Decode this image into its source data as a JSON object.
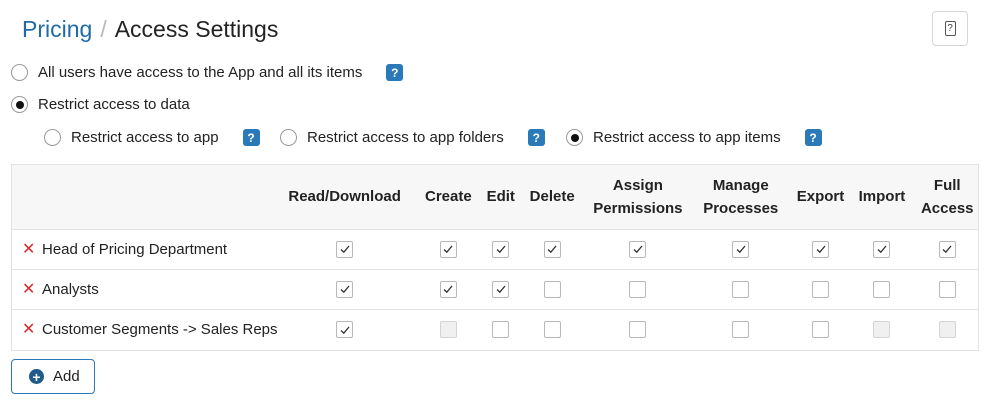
{
  "breadcrumb": {
    "parent": "Pricing",
    "separator": "/",
    "current": "Access Settings"
  },
  "help_button": {
    "icon": "help-icon",
    "glyph": "?"
  },
  "access_mode": [
    {
      "label": "All users have access to the App and all its items",
      "checked": false,
      "has_hint": true
    },
    {
      "label": "Restrict access to data",
      "checked": true,
      "has_hint": false
    }
  ],
  "restrict_options": [
    {
      "label": "Restrict access to app",
      "checked": false
    },
    {
      "label": "Restrict access to app folders",
      "checked": false
    },
    {
      "label": "Restrict access to app items",
      "checked": true
    }
  ],
  "hint_glyph": "?",
  "permissions_table": {
    "columns": [
      {
        "key": "read",
        "label": "Read/Download"
      },
      {
        "key": "create",
        "label": "Create"
      },
      {
        "key": "edit",
        "label": "Edit"
      },
      {
        "key": "delete",
        "label": "Delete"
      },
      {
        "key": "assign",
        "label": "Assign Permissions"
      },
      {
        "key": "manage",
        "label": "Manage Processes"
      },
      {
        "key": "export",
        "label": "Export"
      },
      {
        "key": "import",
        "label": "Import"
      },
      {
        "key": "full",
        "label": "Full Access"
      }
    ],
    "rows": [
      {
        "name": "Head of Pricing Department",
        "checked": [
          true,
          true,
          true,
          true,
          true,
          true,
          true,
          true,
          true
        ],
        "disabled": [
          false,
          false,
          false,
          false,
          false,
          false,
          false,
          false,
          false
        ]
      },
      {
        "name": "Analysts",
        "checked": [
          true,
          true,
          true,
          false,
          false,
          false,
          false,
          false,
          false
        ],
        "disabled": [
          false,
          false,
          false,
          false,
          false,
          false,
          false,
          false,
          false
        ]
      },
      {
        "name": "Customer Segments -> Sales Reps",
        "checked": [
          true,
          false,
          false,
          false,
          false,
          false,
          false,
          false,
          false
        ],
        "disabled": [
          false,
          true,
          false,
          false,
          false,
          false,
          false,
          true,
          true
        ]
      }
    ],
    "delete_glyph": "✕"
  },
  "add_button": {
    "label": "Add",
    "glyph": "+"
  },
  "colors": {
    "accent": "#2a79b8",
    "link": "#1f6ba8",
    "delete": "#d42a2a"
  }
}
